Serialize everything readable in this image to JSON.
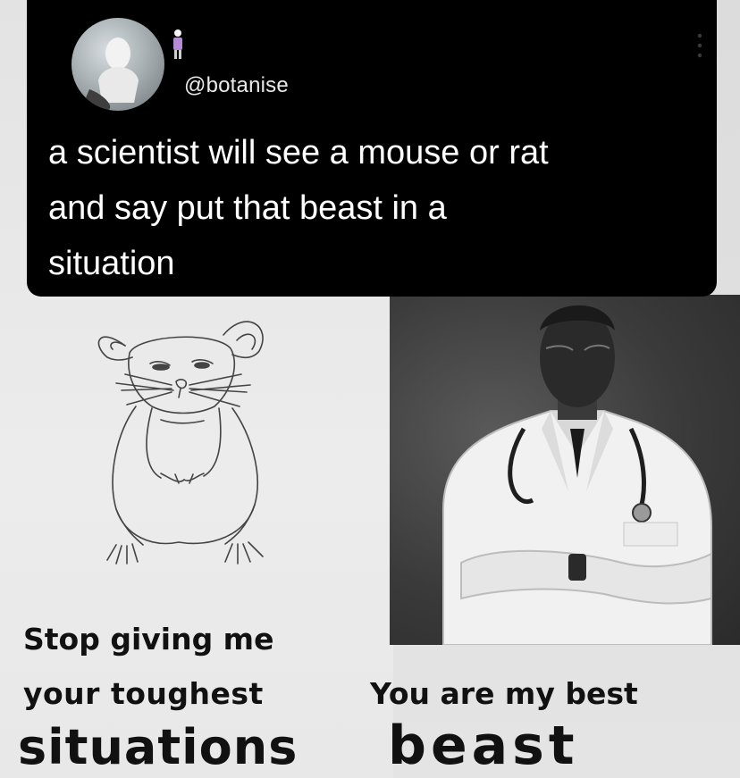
{
  "tweet": {
    "handle": "@botanise",
    "text_lines": [
      "a scientist will see a mouse or rat",
      "and say put that beast in a",
      "situation"
    ]
  },
  "captions": {
    "left_line1": "Stop giving me",
    "left_line2": "your  toughest",
    "left_line3": "situations",
    "right_line1": "You are my best",
    "right_line2": "beast"
  },
  "icons": {
    "avatar": "avatar-image",
    "flag": "person-emoji-icon",
    "more": "vertical-ellipsis-icon"
  },
  "colors": {
    "tweet_bg": "#000000",
    "tweet_text": "#ffffff",
    "caption_text": "#111111",
    "page_bg": "#e6e6e6"
  }
}
